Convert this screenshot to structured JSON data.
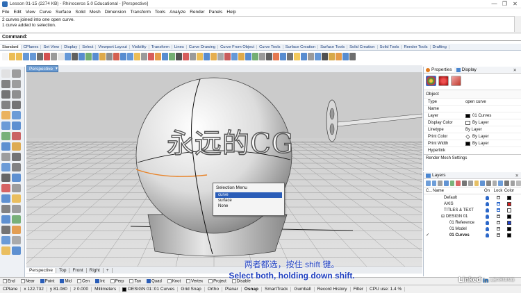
{
  "window": {
    "title": "Lesson 01-15 (2274 KB) - Rhinoceros 5.0 Educational - [Perspective]",
    "minimize": "—",
    "restore": "❐",
    "close": "✕"
  },
  "menu": [
    "File",
    "Edit",
    "View",
    "Curve",
    "Surface",
    "Solid",
    "Mesh",
    "Dimension",
    "Transform",
    "Tools",
    "Analyze",
    "Render",
    "Panels",
    "Help"
  ],
  "history": [
    "2 curves joined into one open curve.",
    "1 curve added to selection."
  ],
  "command": {
    "label": "Command:"
  },
  "toolbar_tabs": [
    "Standard",
    "CPlanes",
    "Set View",
    "Display",
    "Select",
    "Viewport Layout",
    "Visibility",
    "Transform",
    "Lines",
    "Curve Drawing",
    "Curve From Object",
    "Curve Tools",
    "Surface Creation",
    "Surface Tools",
    "Solid Creation",
    "Solid Tools",
    "Render Tools",
    "Drafting"
  ],
  "toolbar_tab_active": "Standard",
  "viewport": {
    "active_tab": "Perspective",
    "tabs": [
      "Perspective",
      "Top",
      "Front",
      "Right"
    ],
    "add_tab": "+"
  },
  "selection_menu": {
    "title": "Selection Menu",
    "items": [
      "curve",
      "surface",
      "None"
    ],
    "highlighted": "curve"
  },
  "watermark": "永远的CG",
  "osnap": [
    {
      "label": "End",
      "on": false
    },
    {
      "label": "Near",
      "on": false
    },
    {
      "label": "Point",
      "on": true
    },
    {
      "label": "Mid",
      "on": true
    },
    {
      "label": "Cen",
      "on": false
    },
    {
      "label": "Int",
      "on": true
    },
    {
      "label": "Perp",
      "on": false
    },
    {
      "label": "Tan",
      "on": false
    },
    {
      "label": "Quad",
      "on": true
    },
    {
      "label": "Knot",
      "on": false
    },
    {
      "label": "Vertex",
      "on": false
    },
    {
      "label": "Project",
      "on": false
    },
    {
      "label": "Disable",
      "on": false
    }
  ],
  "status": {
    "cplane": "CPlane",
    "x": "x 122.732",
    "y": "y 81.080",
    "z": "z 0.000",
    "units": "Millimeters",
    "layer": "DESIGN 01::01 Curves",
    "grid_snap": "Grid Snap",
    "ortho": "Ortho",
    "planar": "Planar",
    "osnap": "Osnap",
    "smarttrack": "SmartTrack",
    "gumball": "Gumball",
    "record_history": "Record History",
    "filter": "Filter",
    "cpu": "CPU use: 1.4 %"
  },
  "properties": {
    "tabs": [
      "Properties",
      "Display"
    ],
    "section": "Object",
    "rows": [
      {
        "label": "Type",
        "value": "open curve",
        "swatch": ""
      },
      {
        "label": "Name",
        "value": "",
        "swatch": ""
      },
      {
        "label": "Layer",
        "value": "01 Curves",
        "swatch": "#000000"
      },
      {
        "label": "Display Color",
        "value": "By Layer",
        "swatch": "#ffffff"
      },
      {
        "label": "Linetype",
        "value": "By Layer",
        "swatch": ""
      },
      {
        "label": "Print Color",
        "value": "By Layer",
        "swatch": "diamond"
      },
      {
        "label": "Print Width",
        "value": "By Layer",
        "swatch": "#000000"
      },
      {
        "label": "Hyperlink",
        "value": "",
        "swatch": ""
      }
    ],
    "footer": "Render Mesh Settings"
  },
  "layers": {
    "title": "Layers",
    "headers": {
      "c": "C...",
      "name": "Name",
      "on": "On",
      "lock": "Lock",
      "color": "Color"
    },
    "rows": [
      {
        "name": "Default",
        "indent": 0,
        "color": "#000000",
        "current": false,
        "bold": false,
        "prefix": ""
      },
      {
        "name": "AXIS",
        "indent": 0,
        "color": "#d62020",
        "current": false,
        "bold": false,
        "prefix": ""
      },
      {
        "name": "TITLES & TEXT",
        "indent": 0,
        "color": "#ffffff",
        "current": false,
        "bold": false,
        "prefix": ""
      },
      {
        "name": "DESIGN 01",
        "indent": 0,
        "color": "#000000",
        "current": false,
        "bold": false,
        "prefix": "⊟"
      },
      {
        "name": "01 Reference",
        "indent": 1,
        "color": "#2040d0",
        "current": false,
        "bold": false,
        "prefix": ""
      },
      {
        "name": "01 Model",
        "indent": 1,
        "color": "#000000",
        "current": false,
        "bold": false,
        "prefix": ""
      },
      {
        "name": "01 Curves",
        "indent": 1,
        "color": "#000000",
        "current": true,
        "bold": true,
        "prefix": ""
      }
    ],
    "current_mark": "✓"
  },
  "subtitles": {
    "zh": "两者都选，按住 shift 键。",
    "en": "Select both, holding down shift."
  },
  "brand": {
    "in": "in",
    "name": "Linked",
    "learning": "LEARNING"
  },
  "colors": {
    "accent": "#2a5db8",
    "highlight_curve": "#e8842a",
    "viewport_bg": "#c8c8c8",
    "grid": "#9a9a9a"
  }
}
